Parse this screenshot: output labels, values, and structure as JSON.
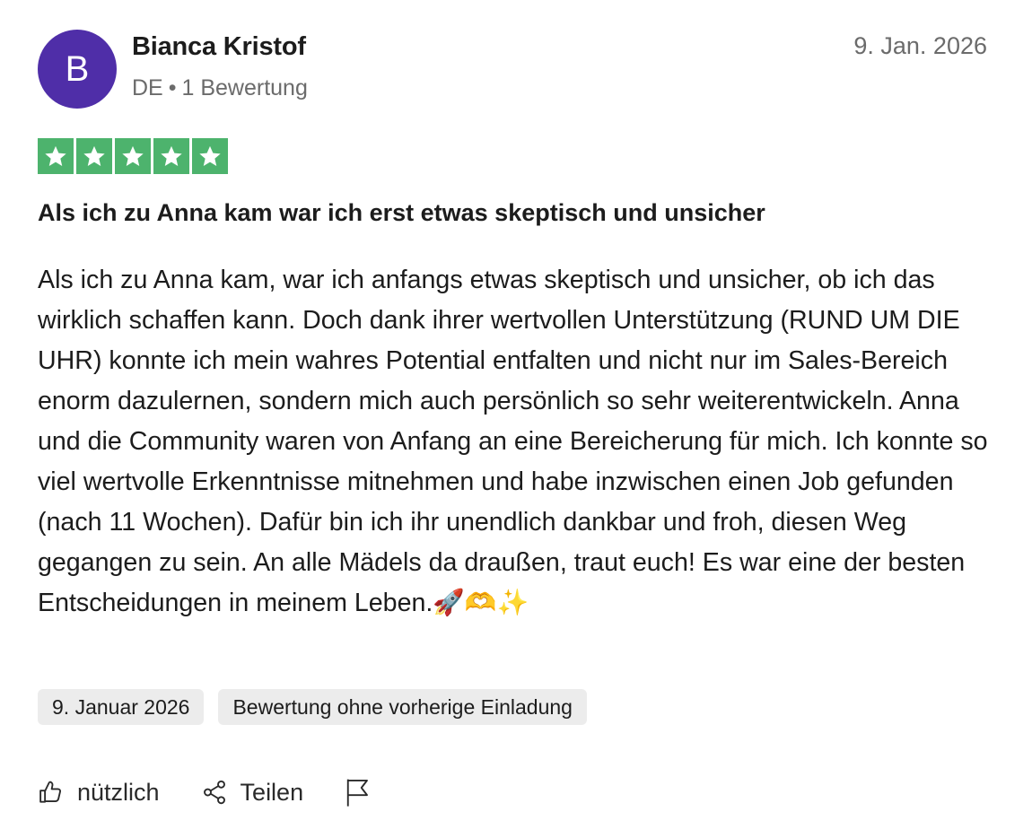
{
  "reviewer": {
    "initial": "B",
    "name": "Bianca Kristof",
    "country": "DE",
    "separator": "•",
    "review_count": "1 Bewertung",
    "avatar_color": "#4f2ea8"
  },
  "review": {
    "date_short": "9. Jan. 2026",
    "rating": 5,
    "star_color": "#4db36d",
    "title": "Als ich zu Anna kam war ich erst etwas skeptisch und unsicher",
    "body": "Als ich zu Anna kam, war ich anfangs etwas skeptisch und unsicher, ob ich das wirklich schaffen kann. Doch dank ihrer wertvollen Unterstützung (RUND UM DIE UHR) konnte ich mein wahres Potential entfalten und nicht nur im Sales-Bereich enorm dazulernen, sondern mich auch persönlich so sehr weiterentwickeln. Anna und die Community waren von Anfang an eine Bereicherung für mich. Ich konnte so viel wertvolle Erkenntnisse mitnehmen und habe inzwischen einen Job gefunden (nach 11 Wochen). Dafür bin ich ihr unendlich dankbar und froh, diesen Weg gegangen zu sein. An alle Mädels da draußen, traut euch! Es war eine der besten Entscheidungen in meinem Leben.🚀🫶✨"
  },
  "tags": {
    "date_full": "9. Januar 2026",
    "invitation": "Bewertung ohne vorherige Einladung"
  },
  "actions": {
    "useful_label": "nützlich",
    "share_label": "Teilen",
    "useful_icon": "thumbs-up-icon",
    "share_icon": "share-icon",
    "report_icon": "flag-icon"
  }
}
